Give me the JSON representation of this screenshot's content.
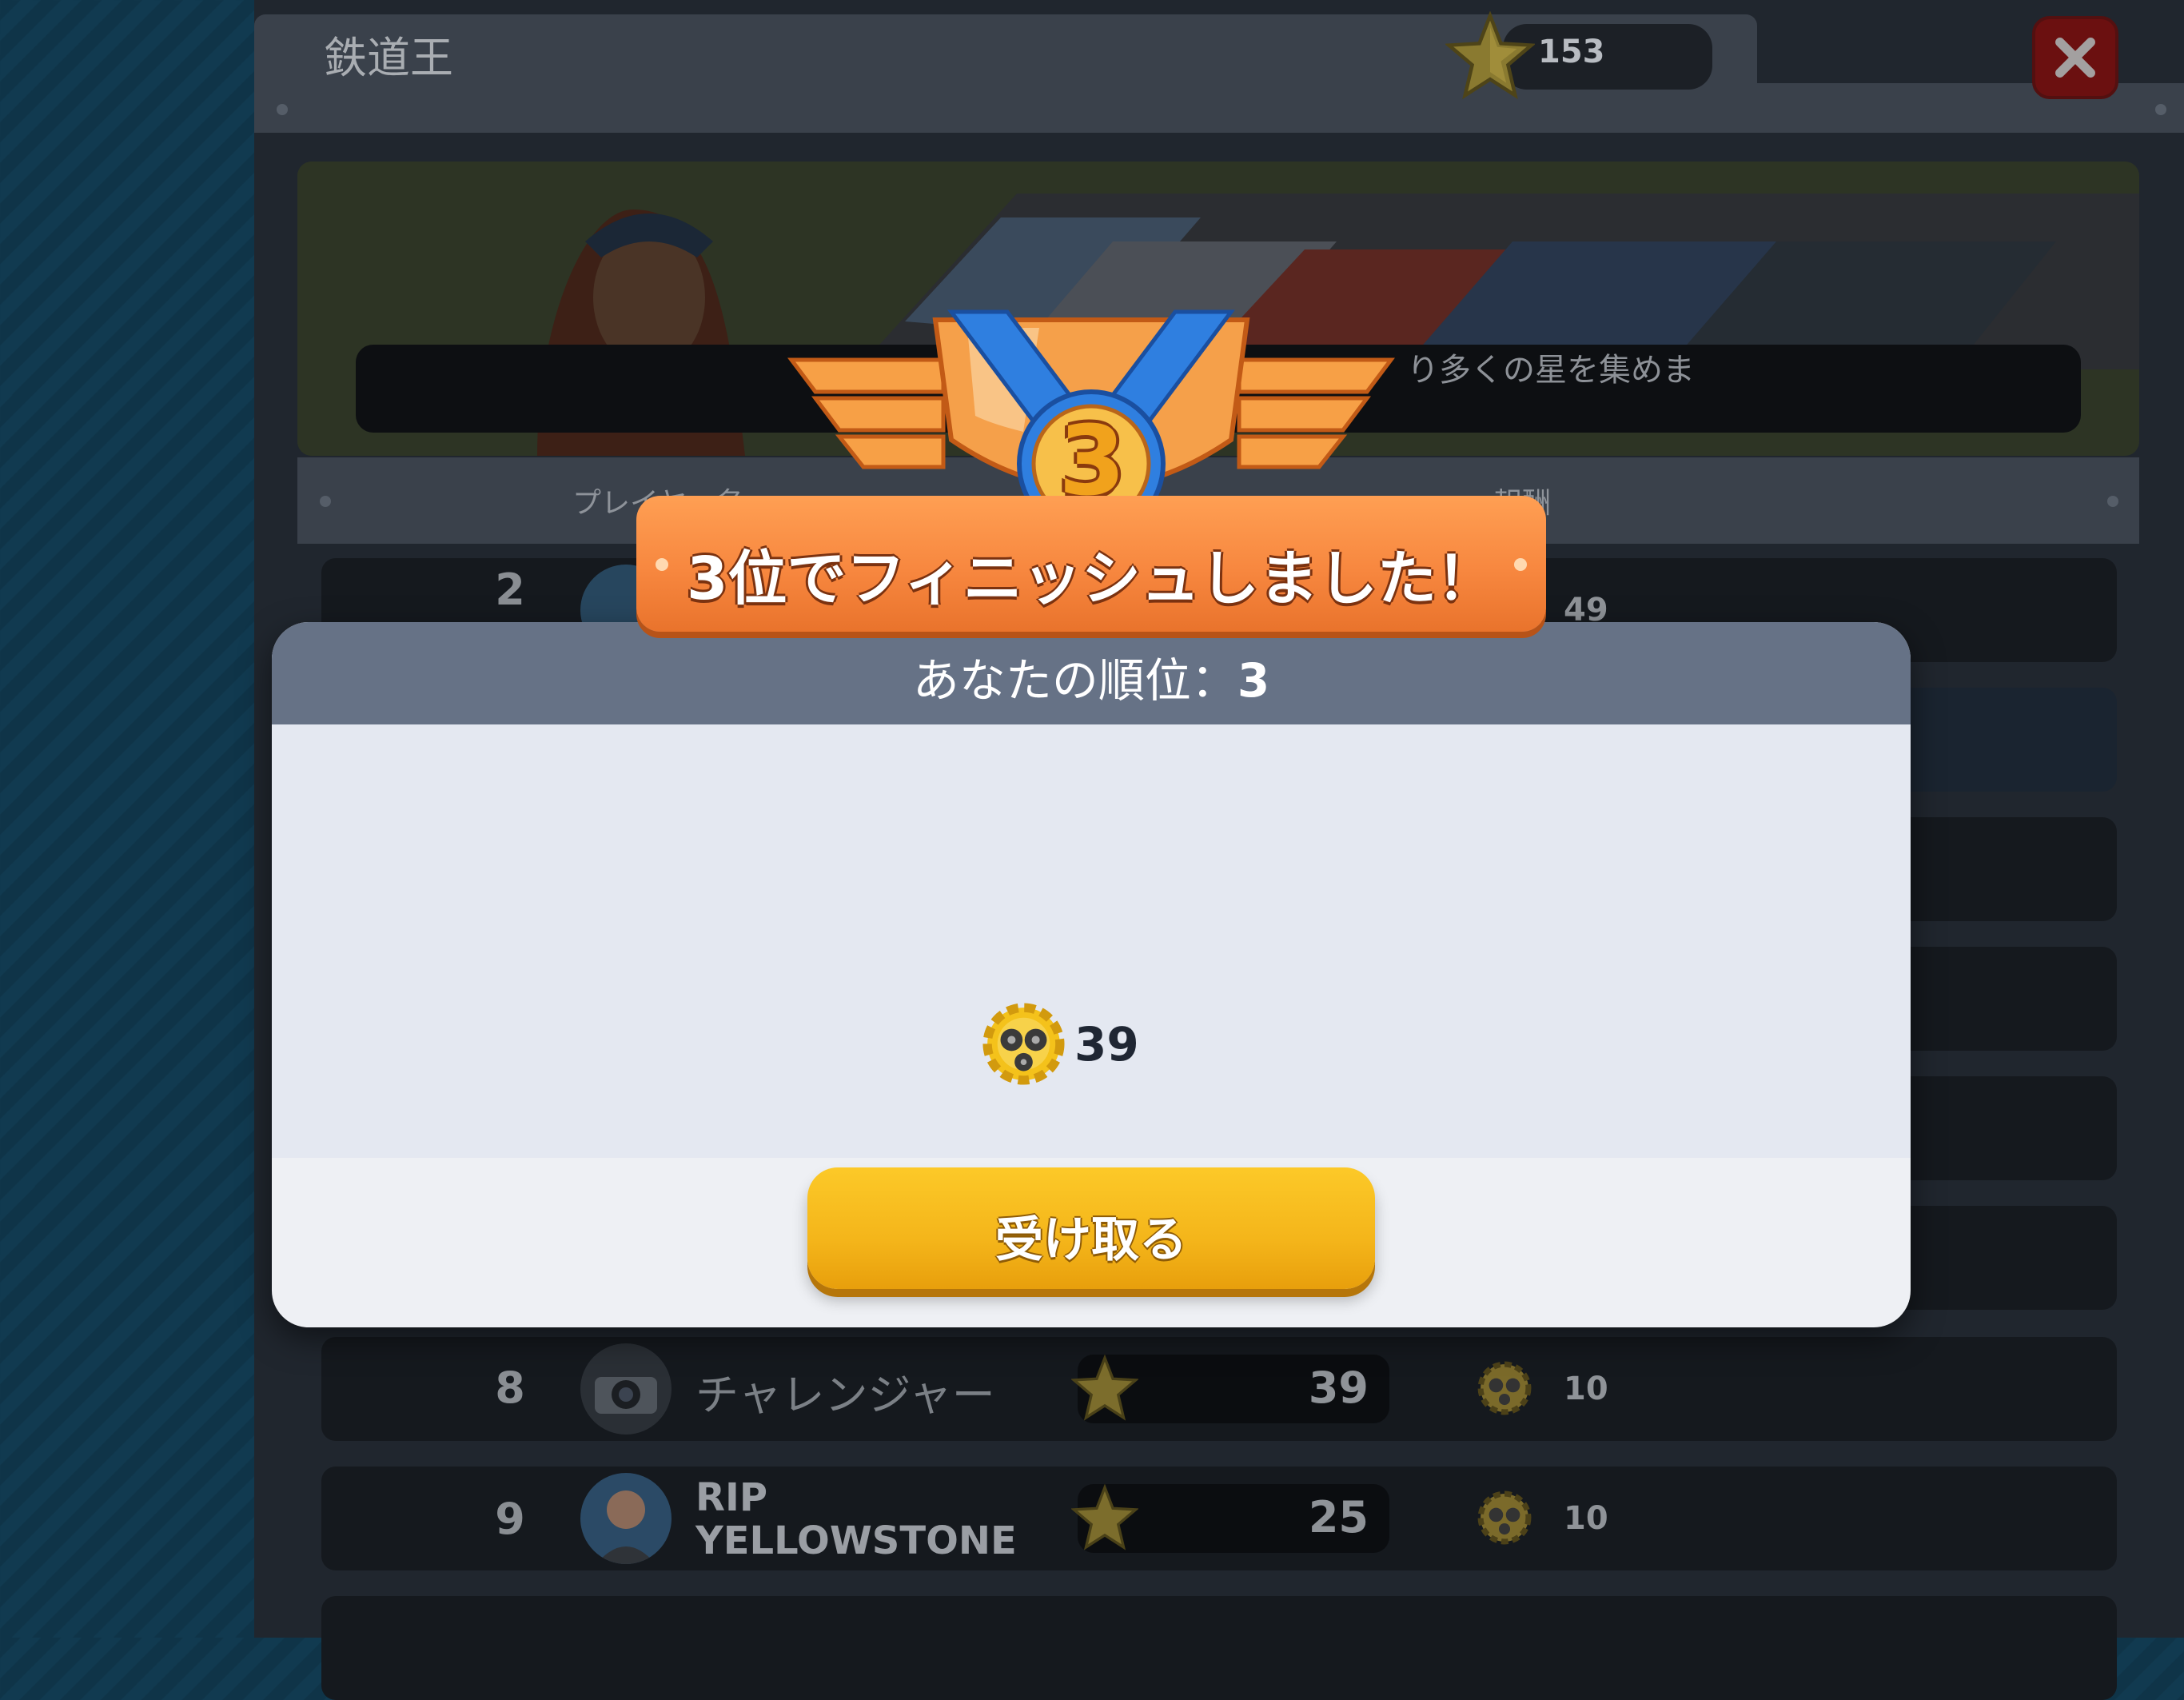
{
  "header": {
    "title": "鉄道王",
    "star_total": "153",
    "close_icon": "close-icon"
  },
  "banner": {
    "instruction_visible": "り多くの星を集めま"
  },
  "table": {
    "column_player": "プレイヤー名",
    "column_reward": "報酬",
    "rows": [
      {
        "rank": "2",
        "name": "",
        "score": "",
        "reward": "49"
      },
      {
        "rank": "8",
        "name": "チャレンジャー",
        "score": "39",
        "reward": "10"
      },
      {
        "rank": "9",
        "name_line1": "RIP",
        "name_line2": "YELLOWSTONE",
        "score": "25",
        "reward": "10"
      }
    ]
  },
  "result": {
    "finish_message": "3位でフィニッシュしました！",
    "medal_number": "3",
    "rank_label": "あなたの順位：",
    "rank_value": "3",
    "reward_amount": "39",
    "reward_icon": "gear-icon",
    "claim_label": "受け取る"
  },
  "colors": {
    "accent_orange": "#f7873f",
    "button_yellow": "#f4b51a",
    "close_red": "#6b1010",
    "modal_header": "#667286"
  }
}
